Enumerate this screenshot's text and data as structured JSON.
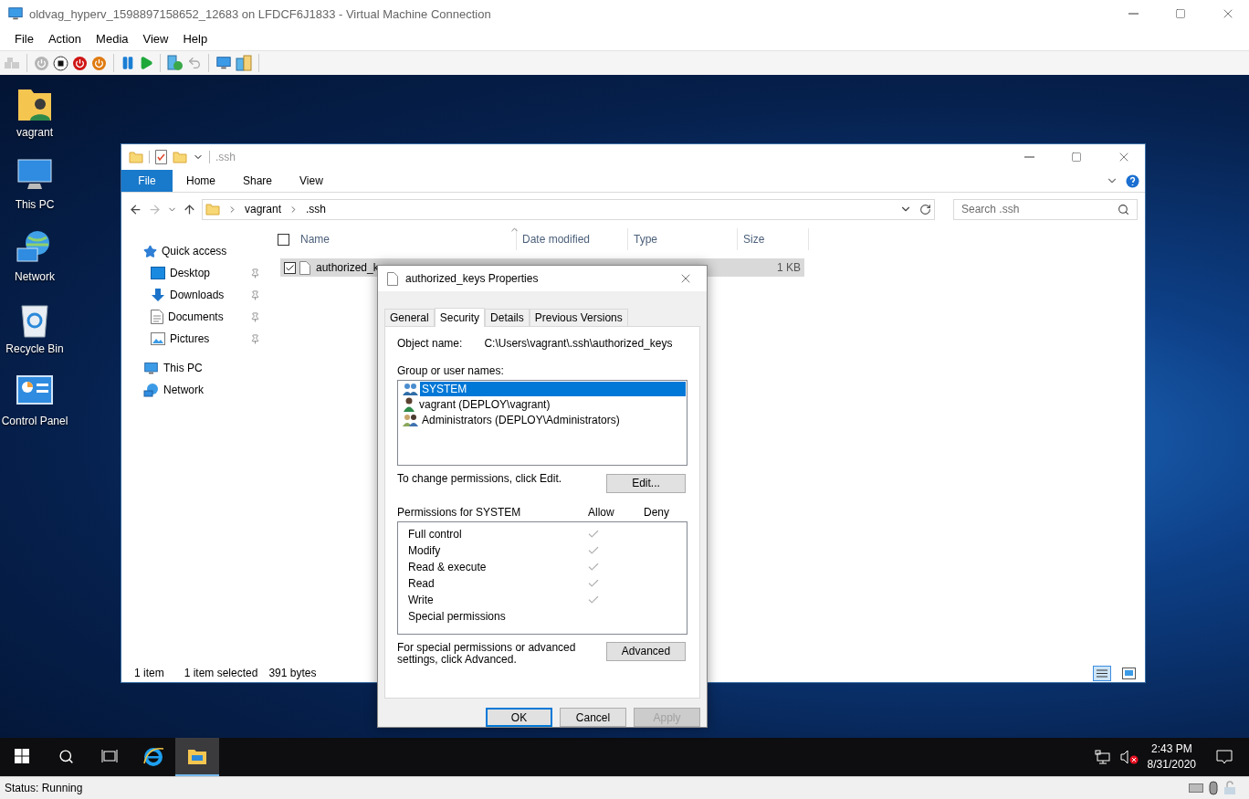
{
  "vm_window": {
    "title": "oldvag_hyperv_1598897158652_12683 on LFDCF6J1833 - Virtual Machine Connection"
  },
  "menu": [
    "File",
    "Action",
    "Media",
    "View",
    "Help"
  ],
  "desktop_icons": [
    {
      "label": "vagrant",
      "kind": "user-folder"
    },
    {
      "label": "This PC",
      "kind": "pc"
    },
    {
      "label": "Network",
      "kind": "network"
    },
    {
      "label": "Recycle Bin",
      "kind": "recycle"
    },
    {
      "label": "Control Panel",
      "kind": "control-panel"
    }
  ],
  "explorer": {
    "title": ".ssh",
    "file_tab": "File",
    "ribbon_tabs": [
      "Home",
      "Share",
      "View"
    ],
    "breadcrumb": [
      "vagrant",
      ".ssh"
    ],
    "search": {
      "placeholder": "Search .ssh"
    },
    "nav": [
      {
        "label": "Quick access",
        "kind": "star",
        "children": [
          {
            "label": "Desktop",
            "kind": "desktop",
            "pinned": true
          },
          {
            "label": "Downloads",
            "kind": "download",
            "pinned": true
          },
          {
            "label": "Documents",
            "kind": "document",
            "pinned": true
          },
          {
            "label": "Pictures",
            "kind": "picture-folder",
            "pinned": true
          }
        ]
      },
      {
        "label": "This PC",
        "kind": "pc"
      },
      {
        "label": "Network",
        "kind": "network"
      }
    ],
    "select_all_checked": false,
    "columns": [
      "Name",
      "Date modified",
      "Type",
      "Size"
    ],
    "rows": [
      {
        "name": "authorized_k",
        "size": "1 KB",
        "checked": true,
        "selected": true
      }
    ],
    "status": [
      "1 item",
      "1 item selected",
      "391 bytes"
    ]
  },
  "properties": {
    "title": "authorized_keys Properties",
    "tabs": [
      {
        "label": "General",
        "selected": false
      },
      {
        "label": "Security",
        "selected": true
      },
      {
        "label": "Details",
        "selected": false
      },
      {
        "label": "Previous Versions",
        "selected": false
      }
    ],
    "object_label": "Object name:",
    "object_value": "C:\\Users\\vagrant\\.ssh\\authorized_keys",
    "group_label": "Group or user names:",
    "users": [
      {
        "name": "SYSTEM",
        "kind": "group",
        "selected": true
      },
      {
        "name": "vagrant (DEPLOY\\vagrant)",
        "kind": "user",
        "selected": false
      },
      {
        "name": "Administrators (DEPLOY\\Administrators)",
        "kind": "admins",
        "selected": false
      }
    ],
    "change_note": "To change permissions, click Edit.",
    "edit_button": "Edit...",
    "permissions_label": "Permissions for SYSTEM",
    "allow_label": "Allow",
    "deny_label": "Deny",
    "permissions": [
      {
        "name": "Full control",
        "allow": true,
        "deny": false
      },
      {
        "name": "Modify",
        "allow": true,
        "deny": false
      },
      {
        "name": "Read & execute",
        "allow": true,
        "deny": false
      },
      {
        "name": "Read",
        "allow": true,
        "deny": false
      },
      {
        "name": "Write",
        "allow": true,
        "deny": false
      },
      {
        "name": "Special permissions",
        "allow": false,
        "deny": false
      }
    ],
    "advanced_note": "For special permissions or advanced settings, click Advanced.",
    "advanced_button": "Advanced",
    "buttons": [
      {
        "label": "OK",
        "kind": "default"
      },
      {
        "label": "Cancel",
        "kind": "normal"
      },
      {
        "label": "Apply",
        "kind": "disabled"
      }
    ]
  },
  "taskbar": {
    "apps": [
      {
        "kind": "ie",
        "selected": false
      },
      {
        "kind": "explorer",
        "selected": true
      }
    ],
    "time": "2:43 PM",
    "date": "8/31/2020"
  },
  "status_bar": {
    "status": "Status: Running"
  }
}
